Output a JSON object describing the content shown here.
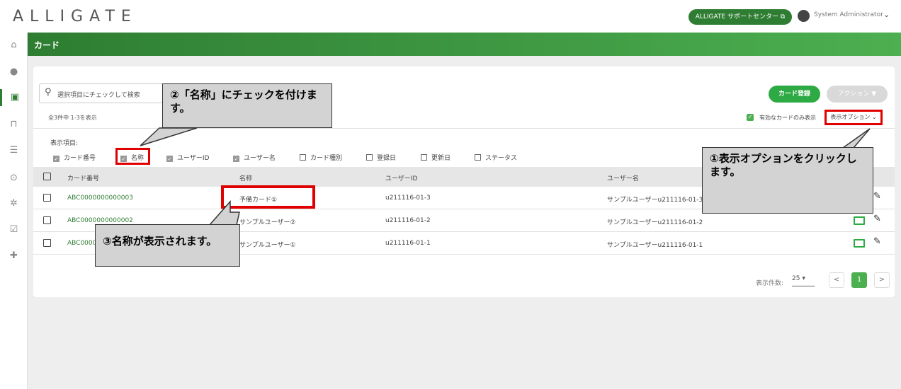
{
  "app": {
    "logo": "ALLIGATE",
    "support_label": "ALLIGATE サポートセンター ⧉",
    "user_name": "System Administrator"
  },
  "sidebar": {
    "icons": [
      "home-icon",
      "user-icon",
      "card-icon",
      "door-icon",
      "list-icon",
      "user-clock-icon",
      "gear-icon",
      "checkbox-icon",
      "puzzle-icon"
    ]
  },
  "page": {
    "title": "カード"
  },
  "toolbar": {
    "search_placeholder": "選択項目にチェックして検索",
    "count": "全3件中 1-3を表示",
    "register_label": "カード登録",
    "action_label": "アクション ▼",
    "valid_only_label": "有効なカードのみ表示",
    "display_options_label": "表示オプション ⌄"
  },
  "display_items": {
    "label": "表示項目:",
    "options": [
      {
        "label": "カード番号",
        "checked": true
      },
      {
        "label": "名称",
        "checked": true
      },
      {
        "label": "ユーザーID",
        "checked": true
      },
      {
        "label": "ユーザー名",
        "checked": true
      },
      {
        "label": "カード種別",
        "checked": false
      },
      {
        "label": "登録日",
        "checked": false
      },
      {
        "label": "更新日",
        "checked": false
      },
      {
        "label": "ステータス",
        "checked": false
      }
    ]
  },
  "table": {
    "headers": [
      "カード番号",
      "名称",
      "ユーザーID",
      "ユーザー名"
    ],
    "rows": [
      {
        "card_no": "ABC0000000000003",
        "name": "予備カード①",
        "user_id": "u211116-01-3",
        "user_name": "サンプルユーザーu211116-01-3"
      },
      {
        "card_no": "ABC0000000000002",
        "name": "サンプルユーザー②",
        "user_id": "u211116-01-2",
        "user_name": "サンプルユーザーu211116-01-2"
      },
      {
        "card_no": "ABC0000000000001",
        "name": "サンプルユーザー①",
        "user_id": "u211116-01-1",
        "user_name": "サンプルユーザーu211116-01-1"
      }
    ]
  },
  "pagination": {
    "per_page_label": "表示件数:",
    "per_page": "25",
    "current_page": "1",
    "prev": "<",
    "next": ">"
  },
  "callouts": {
    "c1": "①表示オプションをクリックします。",
    "c2": "②「名称」にチェックを付けます。",
    "c3": "③名称が表示されます。"
  },
  "colors": {
    "brand": "#2e7d32",
    "accent": "#2eaa45",
    "highlight": "#e00000"
  }
}
